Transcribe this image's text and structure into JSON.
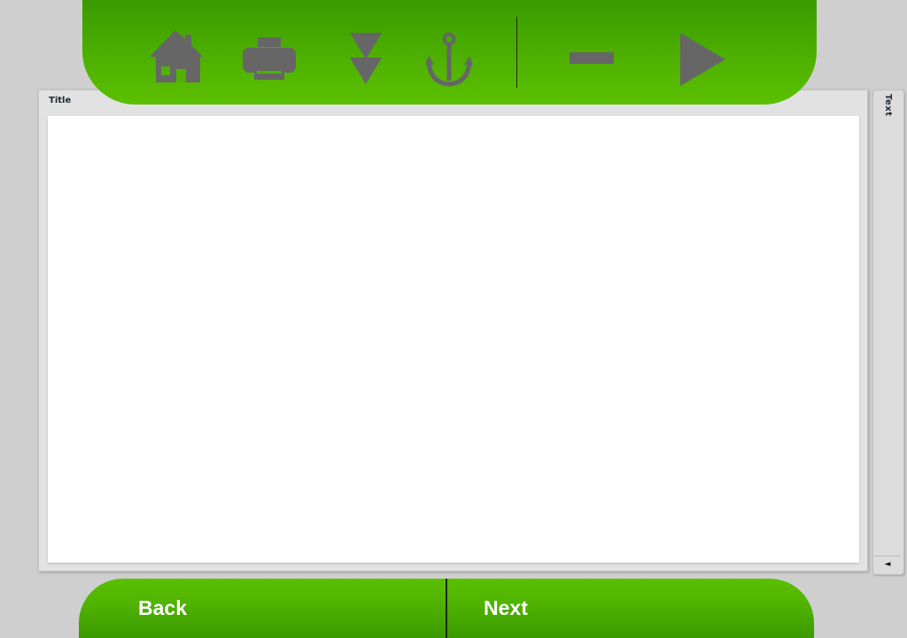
{
  "toolbar": {
    "buttons": [
      {
        "icon": "home-icon"
      },
      {
        "icon": "printer-icon"
      },
      {
        "icon": "double-down-arrow-icon"
      },
      {
        "icon": "anchor-icon"
      },
      {
        "icon": "minus-icon"
      },
      {
        "icon": "play-icon"
      }
    ],
    "icon_color": "#666666",
    "gradient_top": "#3a9a00",
    "gradient_bottom": "#5bc000"
  },
  "panel": {
    "title": "Title"
  },
  "side_tab": {
    "label": "Text",
    "toggle_glyph": "◄"
  },
  "bottom_nav": {
    "back_label": "Back",
    "next_label": "Next"
  }
}
